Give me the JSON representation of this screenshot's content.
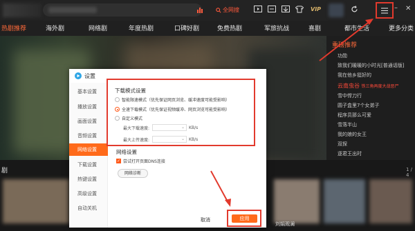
{
  "topbar": {
    "search_button": "全网搜",
    "vip_label": "VIP"
  },
  "nav": {
    "items": [
      "热剧推荐",
      "海外剧",
      "网络剧",
      "年度热剧",
      "口碑好剧",
      "免费热剧",
      "军旅抗战",
      "喜剧",
      "都市生活",
      "更多分类"
    ]
  },
  "hot_list": {
    "title": "重磅推荐",
    "items": [
      "功勋",
      "致我们暖暖的小时光[普通话版]",
      "我在他乡挺好的",
      "云南虫谷",
      "雪中悍刀行",
      "圆子盒里7个女弟子",
      "程序员那么可爱",
      "雪落半山",
      "我的娘的女王",
      "双探",
      "逐君王出时"
    ],
    "highlight_item": "云南虫谷",
    "highlight_sub": "铁三角再度大战恶尸"
  },
  "bottom": {
    "section_label": "剧",
    "page_indicator": "1 / 4",
    "caption": "刘娟观澜"
  },
  "dialog": {
    "title": "设置",
    "sidebar": [
      "基本设置",
      "播放设置",
      "画面设置",
      "音频设置",
      "网络设置",
      "下载设置",
      "热键设置",
      "高级设置",
      "自动关机"
    ],
    "active_index": 4,
    "download_mode": {
      "title": "下载模式设置",
      "options": [
        {
          "label": "智能限速模式（优先保证网页浏览、缓冲速度可能受影响）",
          "selected": false
        },
        {
          "label": "全速下载模式（优先保证视频缓冲、网页浏览可能受影响）",
          "selected": true
        },
        {
          "label": "自定义模式",
          "selected": false
        }
      ],
      "max_download_label": "最大下载速度:",
      "max_upload_label": "最大上传速度:",
      "select_placeholder": "",
      "unit": "KB/s"
    },
    "network": {
      "title": "网络设置",
      "checkbox_label": "尝试打开页面DNS连接",
      "checkbox_checked": true,
      "diagnose_button": "网络诊断"
    },
    "cancel_button": "取消",
    "apply_button": "应用"
  },
  "colors": {
    "accent": "#ff6a1a",
    "annotation": "#e23a2d"
  }
}
